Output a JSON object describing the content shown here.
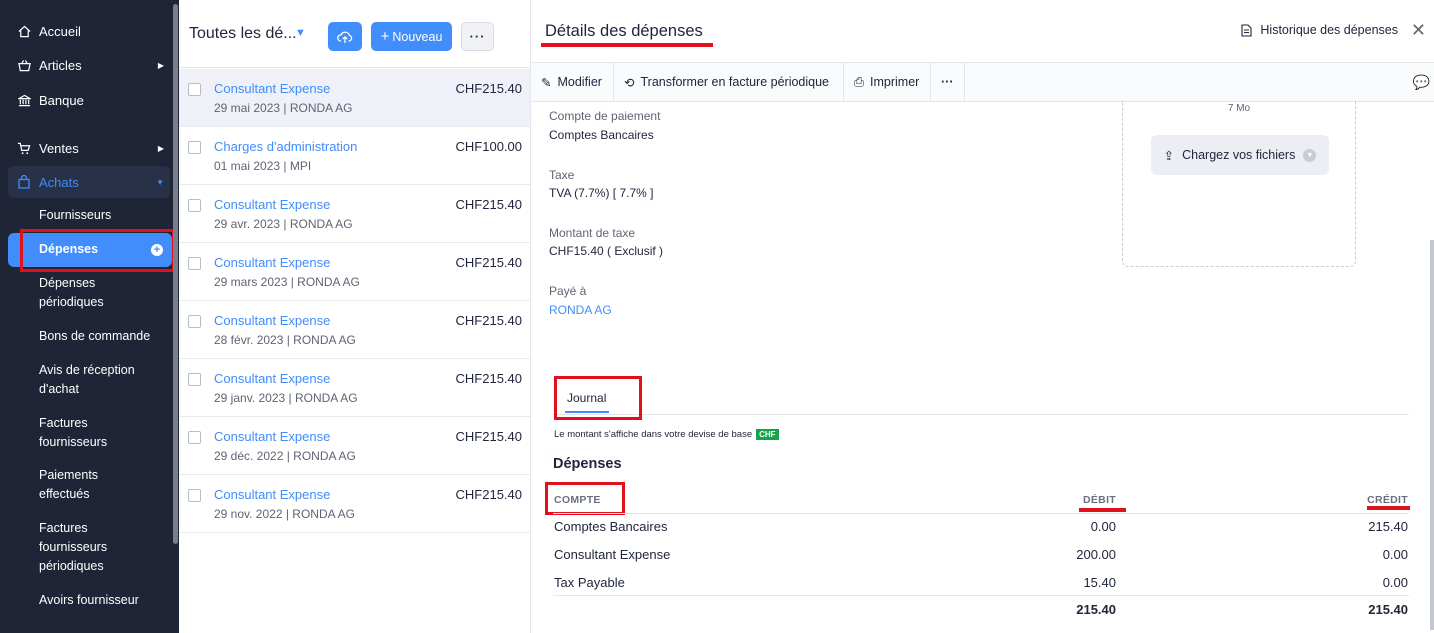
{
  "sidebar": {
    "items": [
      {
        "label": "Accueil",
        "icon": "home-icon"
      },
      {
        "label": "Articles",
        "icon": "basket-icon"
      },
      {
        "label": "Banque",
        "icon": "bank-icon"
      },
      {
        "label": "Ventes",
        "icon": "cart-icon"
      },
      {
        "label": "Achats",
        "icon": "bag-icon"
      }
    ],
    "sub_items": [
      "Fournisseurs",
      "Dépenses",
      "Dépenses périodiques",
      "Bons de commande",
      "Avis de réception d'achat",
      "Factures fournisseurs",
      "Paiements effectués",
      "Factures fournisseurs périodiques",
      "Avoirs fournisseur"
    ]
  },
  "list": {
    "title": "Toutes les dé...",
    "new_label": "Nouveau",
    "rows": [
      {
        "name": "Consultant Expense",
        "meta": "29 mai 2023 | RONDA AG",
        "amount": "CHF215.40"
      },
      {
        "name": "Charges d'administration",
        "meta": "01 mai 2023 | MPI",
        "amount": "CHF100.00"
      },
      {
        "name": "Consultant Expense",
        "meta": "29 avr. 2023 | RONDA AG",
        "amount": "CHF215.40"
      },
      {
        "name": "Consultant Expense",
        "meta": "29 mars 2023 | RONDA AG",
        "amount": "CHF215.40"
      },
      {
        "name": "Consultant Expense",
        "meta": "28 févr. 2023 | RONDA AG",
        "amount": "CHF215.40"
      },
      {
        "name": "Consultant Expense",
        "meta": "29 janv. 2023 | RONDA AG",
        "amount": "CHF215.40"
      },
      {
        "name": "Consultant Expense",
        "meta": "29 déc. 2022 | RONDA AG",
        "amount": "CHF215.40"
      },
      {
        "name": "Consultant Expense",
        "meta": "29 nov. 2022 | RONDA AG",
        "amount": "CHF215.40"
      }
    ]
  },
  "detail": {
    "title": "Détails des dépenses",
    "history_label": "Historique des dépenses",
    "toolbar": {
      "edit": "Modifier",
      "recurring": "Transformer en facture périodique",
      "print": "Imprimer"
    },
    "fields": {
      "payment_account_label": "Compte de paiement",
      "payment_account_value": "Comptes Bancaires",
      "tax_label": "Taxe",
      "tax_value": "TVA (7.7%) [ 7.7% ]",
      "tax_amount_label": "Montant de taxe",
      "tax_amount_value": "CHF15.40 ( Exclusif )",
      "paid_to_label": "Payé à",
      "paid_to_value": "RONDA AG"
    },
    "upload": {
      "size_note": "7 Mo",
      "button": "Chargez vos fichiers"
    },
    "journal": {
      "tab": "Journal",
      "base_note": "Le montant s'affiche dans votre devise de base",
      "currency": "CHF",
      "section_title": "Dépenses",
      "headers": {
        "account": "COMPTE",
        "debit": "DÉBIT",
        "credit": "CRÉDIT"
      },
      "rows": [
        {
          "account": "Comptes Bancaires",
          "debit": "0.00",
          "credit": "215.40"
        },
        {
          "account": "Consultant Expense",
          "debit": "200.00",
          "credit": "0.00"
        },
        {
          "account": "Tax Payable",
          "debit": "15.40",
          "credit": "0.00"
        }
      ],
      "totals": {
        "debit": "215.40",
        "credit": "215.40"
      }
    }
  },
  "colors": {
    "accent": "#408dfb",
    "sidebar": "#1f2536",
    "highlight": "#e0101d"
  }
}
